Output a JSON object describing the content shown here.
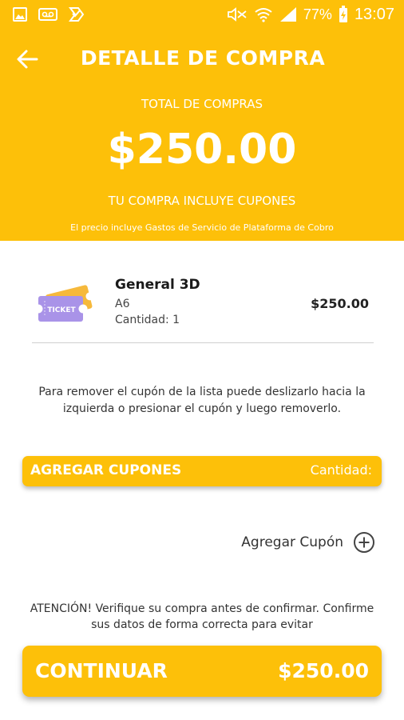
{
  "status_bar": {
    "battery": "77%",
    "time": "13:07",
    "icons": [
      "gallery-icon",
      "voicemail-icon",
      "app-notification-icon",
      "mute-icon",
      "wifi-icon",
      "signal-icon",
      "battery-charging-icon"
    ]
  },
  "header": {
    "title": "DETALLE DE COMPRA",
    "total_label": "TOTAL DE COMPRAS",
    "total_amount": "$250.00",
    "coupon_note": "TU COMPRA INCLUYE CUPONES",
    "fee_note": "El precio incluye Gastos de Servicio de Plataforma de Cobro"
  },
  "ticket": {
    "icon": "ticket-icon",
    "icon_text": "TICKET",
    "name": "General 3D",
    "seat": "A6",
    "quantity": "Cantidad: 1",
    "price": "$250.00"
  },
  "instructions": "Para remover el cupón de la lista puede deslizarlo hacia la izquierda o presionar el cupón y luego removerlo.",
  "coupons": {
    "title": "AGREGAR CUPONES",
    "quantity_label": "Cantidad:",
    "add_label": "Agregar Cupón"
  },
  "warning": "ATENCIÓN! Verifique su compra antes de confirmar. Confirme sus datos de forma correcta para evitar",
  "footer": {
    "continue_label": "CONTINUAR",
    "total": "$250.00"
  },
  "colors": {
    "accent": "#FDC009",
    "ticket_purple": "#A993E8",
    "ticket_orange": "#F6B93B"
  }
}
